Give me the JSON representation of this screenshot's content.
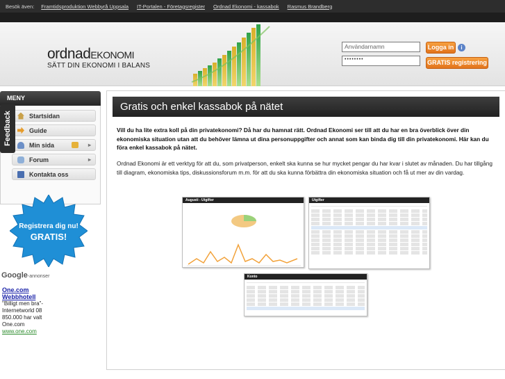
{
  "topbar": {
    "label": "Besök även:",
    "links": [
      "Framtidsproduktion Webbyrå Uppsala",
      "IT-Portalen - Företagsregister",
      "Ordnad Ekonomi - kassabok",
      "Rasmus Brandberg"
    ]
  },
  "logo": {
    "line1_big": "ordnad",
    "line1_small": "EKONOMI",
    "line2": "SÄTT DIN EKONOMI I BALANS"
  },
  "login": {
    "username_placeholder": "Användarnamn",
    "password_value": "••••••••",
    "login_label": "Logga in",
    "info_glyph": "i",
    "register_label": "GRATIS registrering"
  },
  "menu": {
    "title": "MENY",
    "items": [
      {
        "label": "Startsidan",
        "icon": "home-icon"
      },
      {
        "label": "Guide",
        "icon": "arrow-icon"
      },
      {
        "label": "Min sida",
        "icon": "person-icon",
        "has_lock": true,
        "has_arrow": true
      },
      {
        "label": "Forum",
        "icon": "forum-icon",
        "has_arrow": true
      },
      {
        "label": "Kontakta oss",
        "icon": "book-icon"
      }
    ],
    "arrow_glyph": "▸"
  },
  "feedback_label": "Feedback",
  "starburst": {
    "line1": "Registrera dig nu!",
    "line2": "GRATIS!"
  },
  "google": {
    "logo": "Google",
    "suffix": "-annonser"
  },
  "ads": {
    "title1": "One.com",
    "title2": "Webbhotell",
    "body": "\"Billigt men bra\"-Internetworld 08 850.000 har valt One.com",
    "url": "www.one.com"
  },
  "main": {
    "title": "Gratis och enkel kassabok på nätet",
    "intro": "Vill du ha lite extra koll på din privatekonomi? Då har du hamnat rätt. Ordnad Ekonomi ser till att du har en bra överblick över din ekonomiska situation utan att du behöver lämna ut dina personuppgifter och annat som kan binda dig till din privatekonomi. Här kan du föra enkel kassabok på nätet.",
    "description": "Ordnad Ekonomi är ett verktyg för att du, som privatperson, enkelt ska kunna se hur mycket pengar du har kvar i slutet av månaden. Du har tillgång till diagram, ekonomiska tips, diskussionsforum m.m. för att du ska kunna förbättra din ekonomiska situation och få ut mer av din vardag.",
    "screenshots": [
      {
        "title": "Augusti - Utgifter"
      },
      {
        "title": "Utgifter"
      },
      {
        "title": "Konto"
      }
    ]
  },
  "colors": {
    "accent_orange": "#e8801f",
    "dark_bar": "#2d2d2d",
    "link_blue": "#1a22a8"
  }
}
